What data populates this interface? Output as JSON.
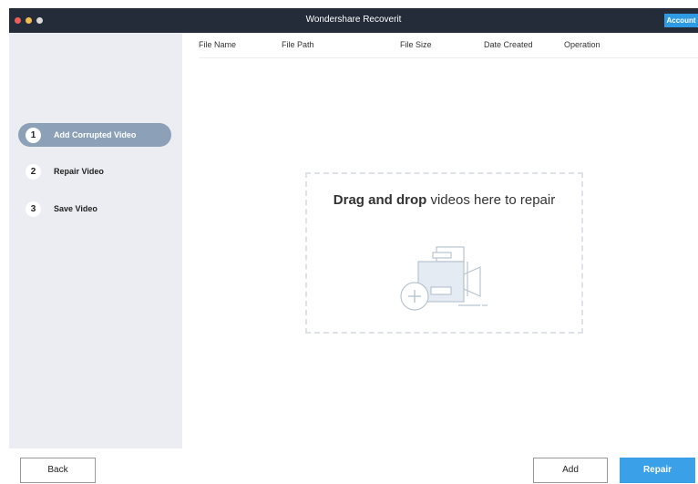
{
  "window": {
    "title": "Wondershare Recoverit",
    "account_label": "Account",
    "traffic_lights": [
      "#ec5f58",
      "#f4bd4f",
      "#dadada"
    ]
  },
  "sidebar": {
    "steps": [
      {
        "number": "1",
        "label": "Add Corrupted Video",
        "active": true
      },
      {
        "number": "2",
        "label": "Repair Video",
        "active": false
      },
      {
        "number": "3",
        "label": "Save Video",
        "active": false
      }
    ]
  },
  "table": {
    "columns": [
      "File Name",
      "File Path",
      "File Size",
      "Date Created",
      "Operation"
    ]
  },
  "dropzone": {
    "text_bold": "Drag and drop",
    "text_rest": " videos here to repair",
    "icon": "video-camera-add-icon"
  },
  "buttons": {
    "back": "Back",
    "add": "Add",
    "repair": "Repair"
  },
  "colors": {
    "titlebar": "#242c3a",
    "accent": "#3aa0e8",
    "active_step": "#8ca1b8",
    "sidebar": "#ebedf2"
  }
}
